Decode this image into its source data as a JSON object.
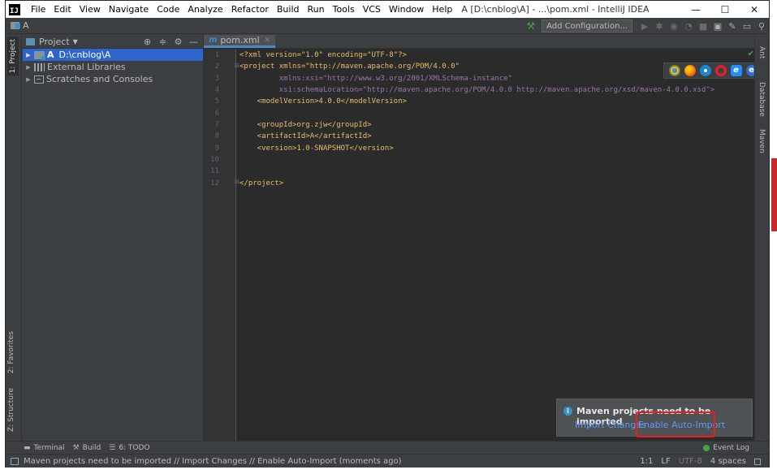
{
  "window": {
    "title": "A [D:\\cnblog\\A] - ...\\pom.xml - IntelliJ IDEA",
    "logo_letter": "IJ",
    "menu": [
      "File",
      "Edit",
      "View",
      "Navigate",
      "Code",
      "Analyze",
      "Refactor",
      "Build",
      "Run",
      "Tools",
      "VCS",
      "Window",
      "Help"
    ],
    "minimize": "—",
    "maximize": "☐",
    "close": "✕"
  },
  "navbar": {
    "breadcrumb": "A",
    "add_configuration": "Add Configuration..."
  },
  "left_tabs": {
    "project": "1: Project",
    "favorites": "2: Favorites",
    "structure": "Z: Structure"
  },
  "right_tabs": {
    "ant": "Ant",
    "database": "Database",
    "maven": "Maven"
  },
  "project_panel": {
    "title": "Project",
    "tree": [
      {
        "name": "A",
        "path": "D:\\cnblog\\A",
        "selected": true
      },
      {
        "name": "External Libraries"
      },
      {
        "name": "Scratches and Consoles"
      }
    ]
  },
  "editor": {
    "tab": "pom.xml",
    "tab_icon": "m",
    "line_numbers": [
      "1",
      "2",
      "3",
      "4",
      "5",
      "6",
      "7",
      "8",
      "9",
      "10",
      "11",
      "12"
    ],
    "lines": [
      "<?xml version=\"1.0\" encoding=\"UTF-8\"?>",
      "<project xmlns=\"http://maven.apache.org/POM/4.0.0\"",
      "         xmlns:xsi=\"http://www.w3.org/2001/XMLSchema-instance\"",
      "         xsi:schemaLocation=\"http://maven.apache.org/POM/4.0.0 http://maven.apache.org/xsd/maven-4.0.0.xsd\">",
      "    <modelVersion>4.0.0</modelVersion>",
      "",
      "    <groupId>org.zjw</groupId>",
      "    <artifactId>A</artifactId>",
      "    <version>1.0-SNAPSHOT</version>",
      "",
      "",
      "</project>"
    ]
  },
  "notification": {
    "title": "Maven projects need to be imported",
    "link_import": "Import Changes",
    "link_auto": "Enable Auto-Import"
  },
  "tool_windows": {
    "terminal": "Terminal",
    "build": "Build",
    "todo": "6: TODO",
    "event_log": "Event Log"
  },
  "statusbar": {
    "message": "Maven projects need to be imported // Import Changes // Enable Auto-Import (moments ago)",
    "position": "1:1",
    "line_sep": "LF",
    "encoding": "UTF-8",
    "indent": "4 spaces"
  },
  "colors": {
    "accent": "#2f65ca",
    "link": "#589df6",
    "highlight": "#ee1c1c"
  }
}
